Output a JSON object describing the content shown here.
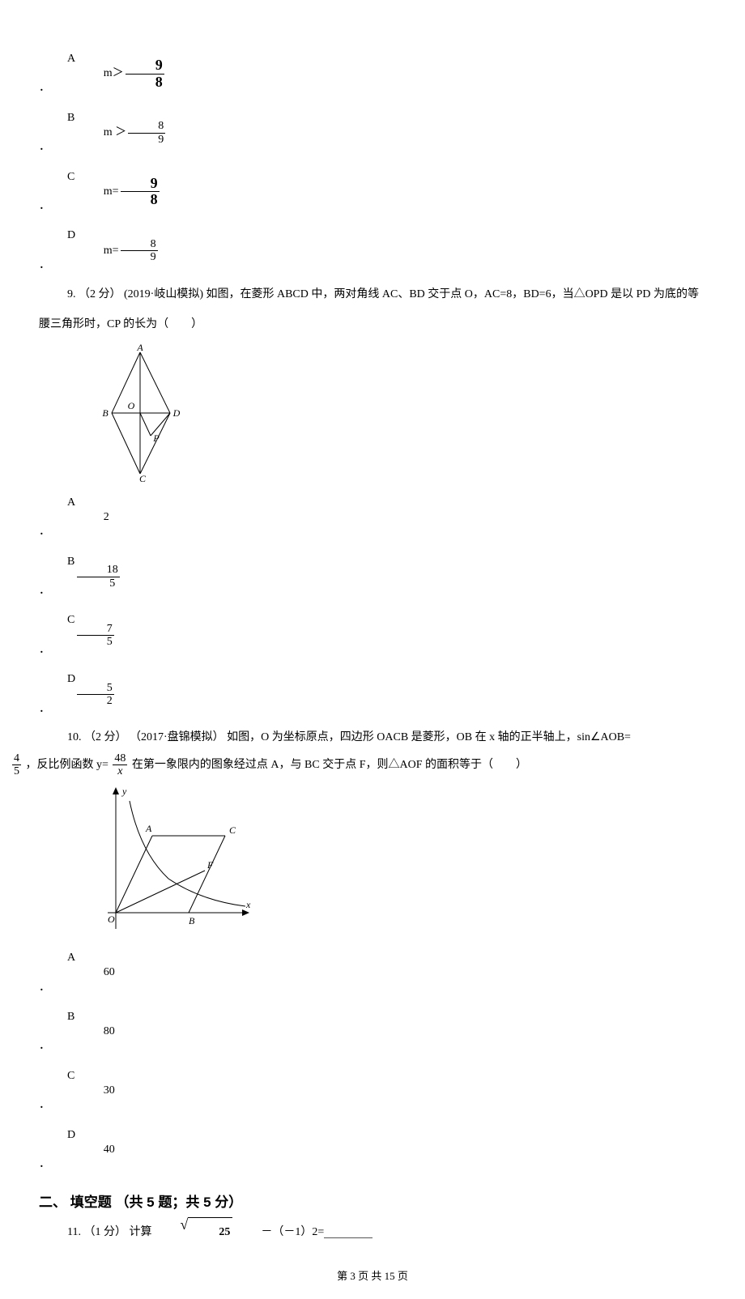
{
  "q8_options": {
    "a": {
      "label": "A ．",
      "prefix": "m＞",
      "num": "9",
      "den": "8",
      "big": true
    },
    "b": {
      "label": "B ．",
      "prefix": "m ＞",
      "num": "8",
      "den": "9",
      "big": false
    },
    "c": {
      "label": "C ．",
      "prefix": "m=",
      "num": "9",
      "den": "8",
      "big": true
    },
    "d": {
      "label": "D ．",
      "prefix": "m=",
      "num": "8",
      "den": "9",
      "big": false
    }
  },
  "q9": {
    "stem": "9.  （2 分） (2019·岐山模拟) 如图，在菱形 ABCD 中，两对角线 AC、BD 交于点 O，AC=8，BD=6，当△OPD 是以 PD 为底的等腰三角形时，CP 的长为（　　）",
    "labels": {
      "A": "A",
      "B": "B",
      "C": "C",
      "D": "D",
      "O": "O",
      "P": "P"
    },
    "options": {
      "a": {
        "label": "A ．",
        "text": "2"
      },
      "b": {
        "label": "B ．",
        "num": "18",
        "den": "5"
      },
      "c": {
        "label": "C ．",
        "num": "7",
        "den": "5"
      },
      "d": {
        "label": "D ．",
        "num": "5",
        "den": "2"
      }
    }
  },
  "q10": {
    "stem_pre": "10.  （2 分） （2017·盘锦模拟） 如图，O 为坐标原点，四边形 OACB 是菱形，OB 在 x 轴的正半轴上，sin∠AOB=",
    "sin": {
      "num": "4",
      "den": "5"
    },
    "mid": "，反比例函数 y= ",
    "func": {
      "num": "48",
      "den": "x"
    },
    "stem_post": " 在第一象限内的图象经过点 A，与 BC 交于点 F，则△AOF 的面积等于（　　）",
    "labels": {
      "y": "y",
      "x": "x",
      "O": "O",
      "A": "A",
      "B": "B",
      "C": "C",
      "F": "F"
    },
    "options": {
      "a": {
        "label": "A ．",
        "text": "60"
      },
      "b": {
        "label": "B ．",
        "text": "80"
      },
      "c": {
        "label": "C ．",
        "text": "30"
      },
      "d": {
        "label": "D ．",
        "text": "40"
      }
    }
  },
  "section2": "二、 填空题 （共 5 题；共 5 分）",
  "q11": {
    "pre": "11.  （1 分） 计算 ",
    "sqrt_arg": "25",
    "post": " －（－1）2="
  },
  "footer": "第 3 页 共 15 页"
}
